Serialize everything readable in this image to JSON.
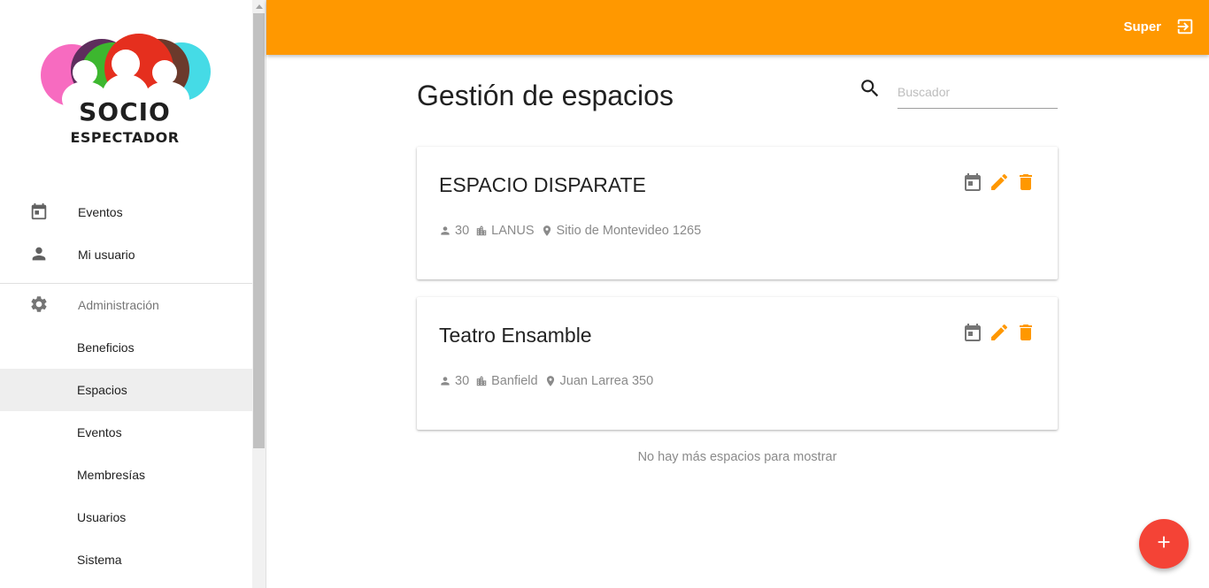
{
  "logo": {
    "line1": "SOCIO",
    "line2": "ESPECTADOR"
  },
  "colors": {
    "accent": "#ff9800",
    "fab": "#f44336",
    "icon_gray": "#757575"
  },
  "sidebar": {
    "items": [
      {
        "label": "Eventos",
        "icon": "calendar-icon"
      },
      {
        "label": "Mi usuario",
        "icon": "person-icon"
      }
    ],
    "admin": {
      "label": "Administración",
      "icon": "gear-icon"
    },
    "admin_items": [
      {
        "label": "Beneficios"
      },
      {
        "label": "Espacios",
        "active": true
      },
      {
        "label": "Eventos"
      },
      {
        "label": "Membresías"
      },
      {
        "label": "Usuarios"
      },
      {
        "label": "Sistema"
      }
    ]
  },
  "topbar": {
    "user": "Super",
    "logout_icon": "logout-icon"
  },
  "page": {
    "title": "Gestión de espacios"
  },
  "search": {
    "placeholder": "Buscador",
    "value": ""
  },
  "spaces": [
    {
      "name": "ESPACIO DISPARATE",
      "capacity": "30",
      "locality": "LANUS",
      "address": "Sitio de Montevideo 1265"
    },
    {
      "name": "Teatro Ensamble",
      "capacity": "30",
      "locality": "Banfield",
      "address": "Juan Larrea 350"
    }
  ],
  "end_message": "No hay más espacios para mostrar",
  "fab": {
    "icon": "plus-icon"
  }
}
